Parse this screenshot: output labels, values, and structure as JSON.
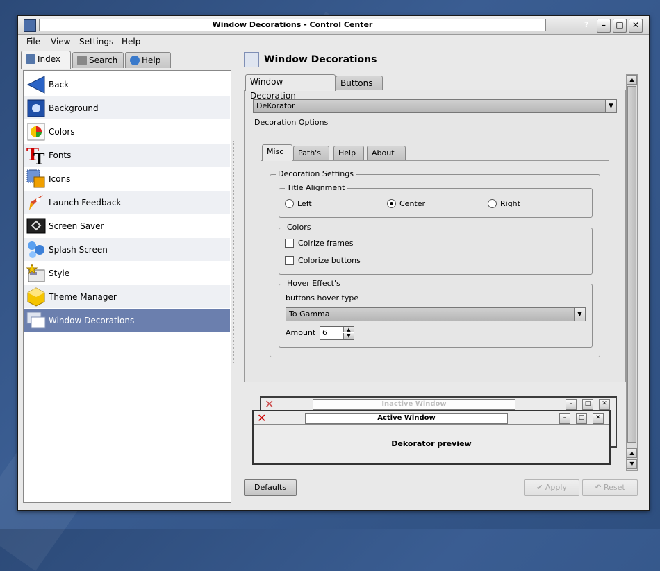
{
  "window": {
    "title": "Window Decorations - Control Center",
    "help_glyph": "?",
    "min_glyph": "–",
    "max_glyph": "□",
    "close_glyph": "✕"
  },
  "menu": {
    "file": "File",
    "view": "View",
    "settings": "Settings",
    "help": "Help"
  },
  "side_tabs": {
    "index": "Index",
    "search": "Search",
    "help": "Help"
  },
  "sidebar": {
    "items": [
      {
        "label": "Back",
        "icon": "back-arrow-icon"
      },
      {
        "label": "Background",
        "icon": "background-icon"
      },
      {
        "label": "Colors",
        "icon": "colors-icon"
      },
      {
        "label": "Fonts",
        "icon": "fonts-icon"
      },
      {
        "label": "Icons",
        "icon": "icons-icon"
      },
      {
        "label": "Launch Feedback",
        "icon": "rocket-icon"
      },
      {
        "label": "Screen Saver",
        "icon": "screensaver-icon"
      },
      {
        "label": "Splash Screen",
        "icon": "splash-icon"
      },
      {
        "label": "Style",
        "icon": "style-icon"
      },
      {
        "label": "Theme Manager",
        "icon": "theme-icon"
      },
      {
        "label": "Window Decorations",
        "icon": "window-decorations-icon"
      }
    ],
    "selected": "Window Decorations"
  },
  "content": {
    "title": "Window Decorations",
    "tabs": {
      "decoration": "Window Decoration",
      "buttons": "Buttons"
    },
    "decoration_combo": "DeKorator",
    "decoration_options": "Decoration Options",
    "inner_tabs": {
      "misc": "Misc",
      "paths": "Path's",
      "help": "Help",
      "about": "About"
    },
    "decoration_settings": "Decoration Settings",
    "title_alignment": {
      "label": "Title Alignment",
      "left": "Left",
      "center": "Center",
      "right": "Right",
      "selected": "center"
    },
    "colors": {
      "label": "Colors",
      "colorize_frames": "Colrize frames",
      "colorize_buttons": "Colorize buttons"
    },
    "hover": {
      "label": "Hover Effect's",
      "type_label": "buttons hover type",
      "type_value": "To Gamma",
      "amount_label": "Amount",
      "amount_value": "6"
    },
    "preview": {
      "inactive_title": "Inactive Window",
      "active_title": "Active Window",
      "body_text": "Dekorator preview"
    }
  },
  "bottom": {
    "defaults": "Defaults",
    "apply": "Apply",
    "reset": "Reset"
  }
}
